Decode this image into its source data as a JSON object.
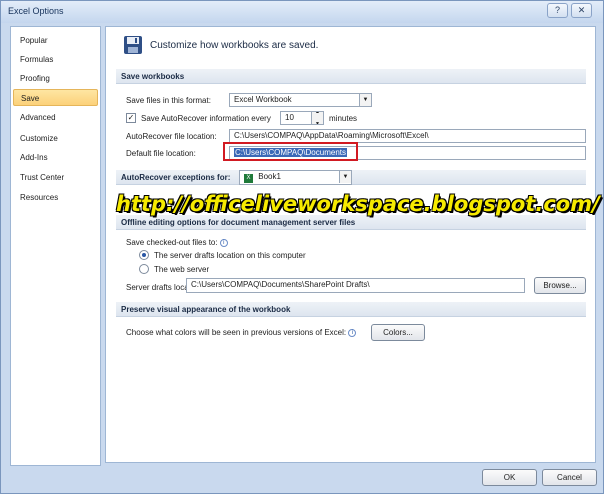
{
  "window": {
    "title": "Excel Options",
    "help_glyph": "?",
    "close_glyph": "✕"
  },
  "sidebar": {
    "items": [
      {
        "label": "Popular"
      },
      {
        "label": "Formulas"
      },
      {
        "label": "Proofing"
      },
      {
        "label": "Save"
      },
      {
        "label": "Advanced"
      },
      {
        "label": "Customize"
      },
      {
        "label": "Add-Ins"
      },
      {
        "label": "Trust Center"
      },
      {
        "label": "Resources"
      }
    ],
    "selected": "Save"
  },
  "header": {
    "text": "Customize how workbooks are saved.",
    "icon": "floppy-disk-icon"
  },
  "save_workbooks": {
    "section_title": "Save workbooks",
    "format_label": "Save files in this format:",
    "format_value": "Excel Workbook",
    "autorecover_label": "Save AutoRecover information every",
    "autorecover_checked": true,
    "autorecover_minutes": "10",
    "minutes_label": "minutes",
    "autorecover_location_label": "AutoRecover file location:",
    "autorecover_location_value": "C:\\Users\\COMPAQ\\AppData\\Roaming\\Microsoft\\Excel\\",
    "default_location_label": "Default file location:",
    "default_location_value": "C:\\Users\\COMPAQ\\Documents"
  },
  "exceptions": {
    "label": "AutoRecover exceptions for:",
    "workbook": "Book1"
  },
  "watermark": "http://officeliveworkspace.blogspot.com/",
  "offline": {
    "section_title": "Offline editing options for document management server files",
    "save_to_label": "Save checked-out files to:",
    "option_server": "The server drafts location on this computer",
    "option_web": "The web server",
    "selected_option": "server",
    "drafts_label": "Server drafts location:",
    "drafts_value": "C:\\Users\\COMPAQ\\Documents\\SharePoint Drafts\\",
    "browse_label": "Browse..."
  },
  "preserve": {
    "section_title": "Preserve visual appearance of the workbook",
    "colors_label": "Choose what colors will be seen in previous versions of Excel:",
    "colors_button": "Colors..."
  },
  "footer": {
    "ok_label": "OK",
    "cancel_label": "Cancel"
  },
  "colors": {
    "highlight": "#d11a22",
    "selection": "#3b69b7",
    "watermark": "#f6ea00"
  }
}
